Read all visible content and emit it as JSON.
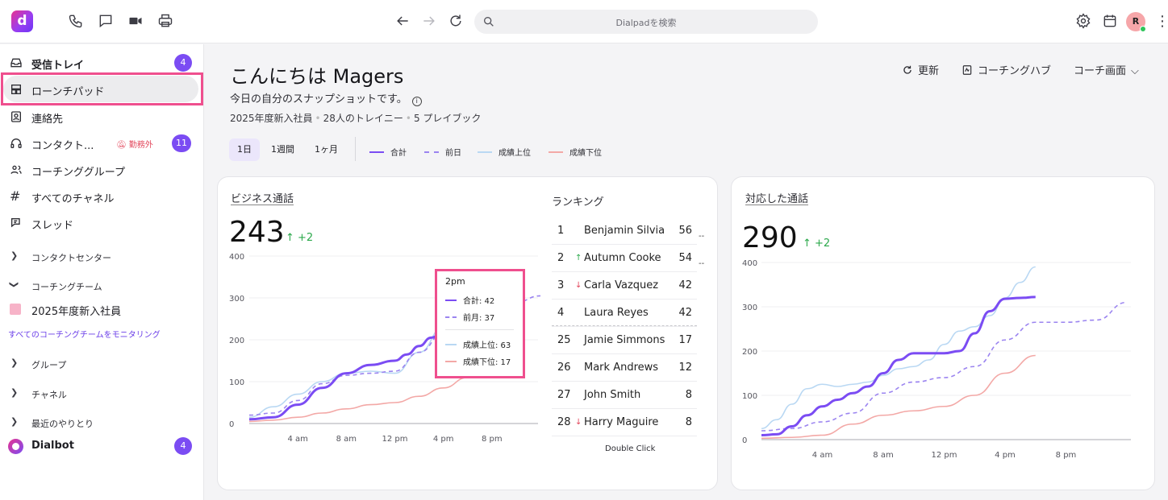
{
  "app": {
    "logo_letter": "d",
    "search_placeholder": "Dialpadを検索",
    "avatar_initial": "R"
  },
  "topbar_icons": [
    "phone-icon",
    "chat-icon",
    "video-icon",
    "print-icon",
    "back-arrow-icon",
    "forward-arrow-icon",
    "reload-icon",
    "settings-icon",
    "calendar-icon",
    "kebab-icon"
  ],
  "sidebar": {
    "inbox": {
      "label": "受信トレイ",
      "badge": "4"
    },
    "launchpad": {
      "label": "ローンチパッド"
    },
    "contacts": {
      "label": "連絡先"
    },
    "contact_center": {
      "label": "コンタクト...",
      "status": "勤務外",
      "badge": "11"
    },
    "coaching_groups": {
      "label": "コーチンググループ"
    },
    "all_channels": {
      "label": "すべてのチャネル"
    },
    "threads": {
      "label": "スレッド"
    },
    "section_contact_center": "コンタクトセンター",
    "section_coaching_team": "コーチングチーム",
    "team_item": "2025年度新入社員",
    "monitor_link": "すべてのコーチングチームをモニタリング",
    "section_groups": "グループ",
    "section_channels": "チャネル",
    "section_recent": "最近のやりとり",
    "dialbot": {
      "label": "Dialbot",
      "badge": "4"
    }
  },
  "header": {
    "greeting": "こんにちは Magers",
    "subtitle": "今日の自分のスナップショットです。",
    "meta_team": "2025年度新入社員",
    "meta_trainees": "28人のトレイニー",
    "meta_playbooks": "5 プレイブック",
    "refresh": "更新",
    "coaching_hub": "コーチングハブ",
    "coach_view": "コーチ画面"
  },
  "filters": {
    "periods": [
      "1日",
      "1週間",
      "1ヶ月"
    ],
    "active_period": "1日",
    "legend": [
      {
        "label": "合計",
        "color": "#7b4cf3",
        "style": "solid"
      },
      {
        "label": "前日",
        "color": "#9b84f0",
        "style": "dashed"
      },
      {
        "label": "成績上位",
        "color": "#b9d8f3",
        "style": "solid"
      },
      {
        "label": "成績下位",
        "color": "#f3a8a6",
        "style": "solid"
      }
    ]
  },
  "business_card": {
    "title": "ビジネス通話",
    "value": "243",
    "delta": "+2",
    "ranking_title": "ランキング",
    "ranking": [
      {
        "rank": "1",
        "trend": "",
        "name": "Benjamin Silvia",
        "score": "56"
      },
      {
        "rank": "2",
        "trend": "up",
        "name": "Autumn Cooke",
        "score": "54"
      },
      {
        "rank": "3",
        "trend": "down",
        "name": "Carla Vazquez",
        "score": "42"
      },
      {
        "rank": "4",
        "trend": "",
        "name": "Laura Reyes",
        "score": "42"
      },
      {
        "rank": "25",
        "trend": "",
        "name": "Jamie Simmons",
        "score": "17"
      },
      {
        "rank": "26",
        "trend": "",
        "name": "Mark Andrews",
        "score": "12"
      },
      {
        "rank": "27",
        "trend": "",
        "name": "John Smith",
        "score": "8"
      },
      {
        "rank": "28",
        "trend": "down",
        "name": "Harry Maguire",
        "score": "8"
      }
    ],
    "double_click": "Double Click",
    "dash_marks": [
      "--",
      "--"
    ],
    "tooltip": {
      "time": "2pm",
      "rows": [
        {
          "label": "合計: 42",
          "color": "#7b4cf3",
          "style": "solid"
        },
        {
          "label": "前月: 37",
          "color": "#9b84f0",
          "style": "dashed"
        },
        {
          "label": "成績上位: 63",
          "color": "#b9d8f3",
          "style": "solid"
        },
        {
          "label": "成績下位: 17",
          "color": "#f3a8a6",
          "style": "solid"
        }
      ]
    }
  },
  "handled_card": {
    "title": "対応した通話",
    "value": "290",
    "delta": "+2"
  },
  "chart_data": [
    {
      "type": "line",
      "title": "ビジネス通話",
      "x": [
        "0",
        "1",
        "2",
        "3",
        "4",
        "5",
        "6",
        "7",
        "8",
        "9",
        "10",
        "11",
        "12",
        "13",
        "14",
        "15",
        "16",
        "17",
        "18",
        "19",
        "20",
        "21",
        "22",
        "23"
      ],
      "xtick_labels": [
        "4 am",
        "8 am",
        "12 pm",
        "4 pm",
        "8 pm"
      ],
      "xtick_hours": [
        4,
        8,
        12,
        16,
        20
      ],
      "ylim": [
        0,
        400
      ],
      "yticks": [
        0,
        100,
        200,
        300,
        400
      ],
      "grid": true,
      "series": [
        {
          "name": "合計",
          "color": "#7b4cf3",
          "style": "solid",
          "hours": [
            0,
            2,
            4,
            6,
            8,
            10,
            12,
            13,
            14,
            15,
            16,
            17,
            18
          ],
          "values": [
            10,
            15,
            45,
            85,
            120,
            140,
            150,
            165,
            185,
            205,
            220,
            235,
            243
          ]
        },
        {
          "name": "前日",
          "color": "#9b84f0",
          "style": "dashed",
          "hours": [
            0,
            2,
            4,
            6,
            8,
            10,
            12,
            14,
            16,
            18,
            20,
            22,
            24
          ],
          "values": [
            20,
            25,
            55,
            95,
            115,
            120,
            125,
            170,
            215,
            250,
            275,
            290,
            305
          ]
        },
        {
          "name": "成績上位",
          "color": "#b9d8f3",
          "style": "solid",
          "hours": [
            0,
            2,
            4,
            6,
            8,
            10,
            12,
            14,
            16,
            18
          ],
          "values": [
            15,
            40,
            70,
            100,
            120,
            125,
            120,
            170,
            230,
            290
          ]
        },
        {
          "name": "成績下位",
          "color": "#f3a8a6",
          "style": "solid",
          "hours": [
            0,
            2,
            4,
            6,
            8,
            10,
            12,
            14,
            16,
            18
          ],
          "values": [
            5,
            8,
            15,
            25,
            35,
            45,
            50,
            65,
            85,
            110
          ]
        }
      ]
    },
    {
      "type": "line",
      "title": "対応した通話",
      "xtick_labels": [
        "4 am",
        "8 am",
        "12 pm",
        "4 pm",
        "8 pm"
      ],
      "xtick_hours": [
        4,
        8,
        12,
        16,
        20
      ],
      "ylim": [
        0,
        400
      ],
      "yticks": [
        0,
        100,
        200,
        300,
        400
      ],
      "grid": true,
      "series": [
        {
          "name": "合計",
          "color": "#7b4cf3",
          "style": "solid",
          "hours": [
            0,
            1,
            2,
            3,
            4,
            5,
            6,
            7,
            8,
            9,
            10,
            11,
            12,
            13,
            14,
            15,
            16,
            17,
            18
          ],
          "values": [
            10,
            12,
            30,
            55,
            75,
            90,
            105,
            120,
            150,
            180,
            195,
            195,
            195,
            200,
            240,
            290,
            318,
            320,
            322
          ]
        },
        {
          "name": "前日",
          "color": "#9b84f0",
          "style": "dashed",
          "hours": [
            0,
            2,
            4,
            6,
            8,
            10,
            12,
            14,
            16,
            18,
            20,
            22,
            24
          ],
          "values": [
            20,
            25,
            40,
            60,
            105,
            130,
            140,
            165,
            225,
            265,
            265,
            270,
            310
          ]
        },
        {
          "name": "成績上位",
          "color": "#b9d8f3",
          "style": "solid",
          "hours": [
            0,
            1,
            2,
            3,
            4,
            5,
            6,
            7,
            8,
            9,
            10,
            11,
            12,
            13,
            14,
            15,
            16,
            17,
            18
          ],
          "values": [
            25,
            45,
            80,
            115,
            125,
            120,
            125,
            130,
            145,
            160,
            165,
            180,
            215,
            245,
            255,
            280,
            320,
            355,
            390
          ]
        },
        {
          "name": "成績下位",
          "color": "#f3a8a6",
          "style": "solid",
          "hours": [
            0,
            2,
            4,
            6,
            8,
            10,
            12,
            14,
            16,
            18
          ],
          "values": [
            3,
            5,
            10,
            35,
            55,
            65,
            75,
            100,
            150,
            190
          ]
        }
      ]
    }
  ]
}
